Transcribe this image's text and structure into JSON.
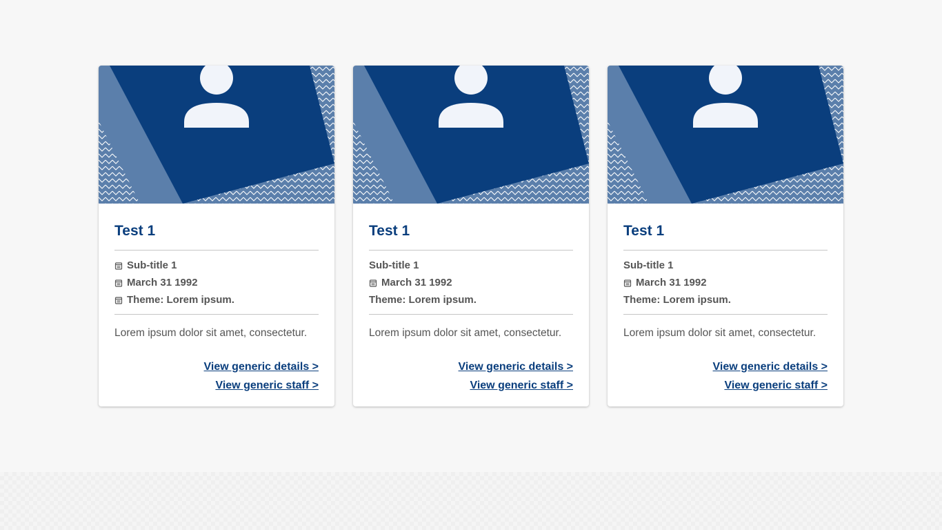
{
  "cards": [
    {
      "title": "Test 1",
      "subtitle": "Sub-title 1",
      "date": "March 31 1992",
      "theme": "Theme: Lorem ipsum.",
      "description": "Lorem ipsum dolor sit amet, consectetur.",
      "details_link": "View generic details >",
      "staff_link": "View generic staff >",
      "icons": [
        "calendar-icon",
        "calendar-icon",
        "calendar-icon"
      ]
    },
    {
      "title": "Test 1",
      "subtitle": "Sub-title 1",
      "date": "March 31 1992",
      "theme": "Theme: Lorem ipsum.",
      "description": "Lorem ipsum dolor sit amet, consectetur.",
      "details_link": "View generic details >",
      "staff_link": "View generic staff >",
      "icons": [
        "calendar-icon"
      ]
    },
    {
      "title": "Test 1",
      "subtitle": "Sub-title 1",
      "date": "March 31 1992",
      "theme": "Theme: Lorem ipsum.",
      "description": "Lorem ipsum dolor sit amet, consectetur.",
      "details_link": "View generic details >",
      "staff_link": "View generic staff >",
      "icons": [
        "calendar-icon"
      ]
    }
  ],
  "colors": {
    "primary": "#0a3e7d",
    "image_bg": "#5b7fab",
    "avatar": "#f1f4fa",
    "text_muted": "#555555",
    "divider": "#c5c5c5"
  }
}
